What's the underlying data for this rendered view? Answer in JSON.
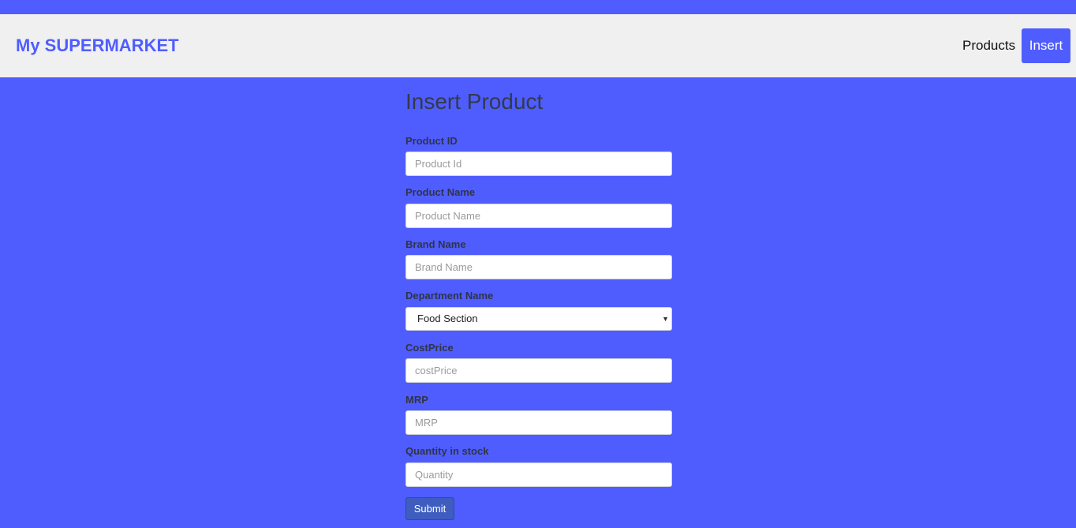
{
  "header": {
    "brand": "My SUPERMARKET",
    "nav": {
      "products": "Products",
      "insert": "Insert"
    }
  },
  "form": {
    "title": "Insert Product",
    "fields": {
      "product_id": {
        "label": "Product ID",
        "placeholder": "Product Id",
        "value": ""
      },
      "product_name": {
        "label": "Product Name",
        "placeholder": "Product Name",
        "value": ""
      },
      "brand_name": {
        "label": "Brand Name",
        "placeholder": "Brand Name",
        "value": ""
      },
      "department": {
        "label": "Department Name",
        "selected": "Food Section"
      },
      "cost_price": {
        "label": "CostPrice",
        "placeholder": "costPrice",
        "value": ""
      },
      "mrp": {
        "label": "MRP",
        "placeholder": "MRP",
        "value": ""
      },
      "quantity": {
        "label": "Quantity in stock",
        "placeholder": "Quantity",
        "value": ""
      }
    },
    "submit_label": "Submit"
  },
  "colors": {
    "background": "#4f5dff",
    "header_bg": "#f0f0f0",
    "brand": "#4f5dff",
    "submit_bg": "#3e5dbf"
  },
  "icons": {
    "select_arrow": "chevron-down-icon"
  }
}
